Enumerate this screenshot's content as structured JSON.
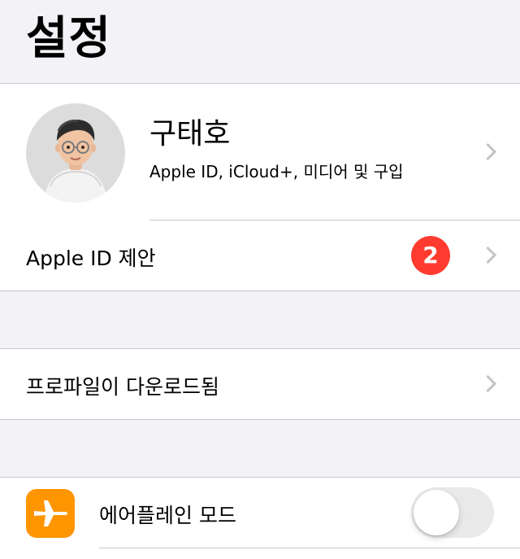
{
  "header": {
    "title": "설정"
  },
  "profile": {
    "name": "구태호",
    "subtitle": "Apple ID, iCloud+, 미디어 및 구입"
  },
  "suggestions": {
    "label": "Apple ID 제안",
    "badge": "2"
  },
  "profile_download": {
    "label": "프로파일이 다운로드됨"
  },
  "airplane": {
    "label": "에어플레인 모드",
    "toggle_on": false
  },
  "colors": {
    "background": "#f2f2f7",
    "badge": "#ff3b30",
    "airplane_icon": "#ff9500",
    "toggle_off": "#e9e9ea"
  }
}
